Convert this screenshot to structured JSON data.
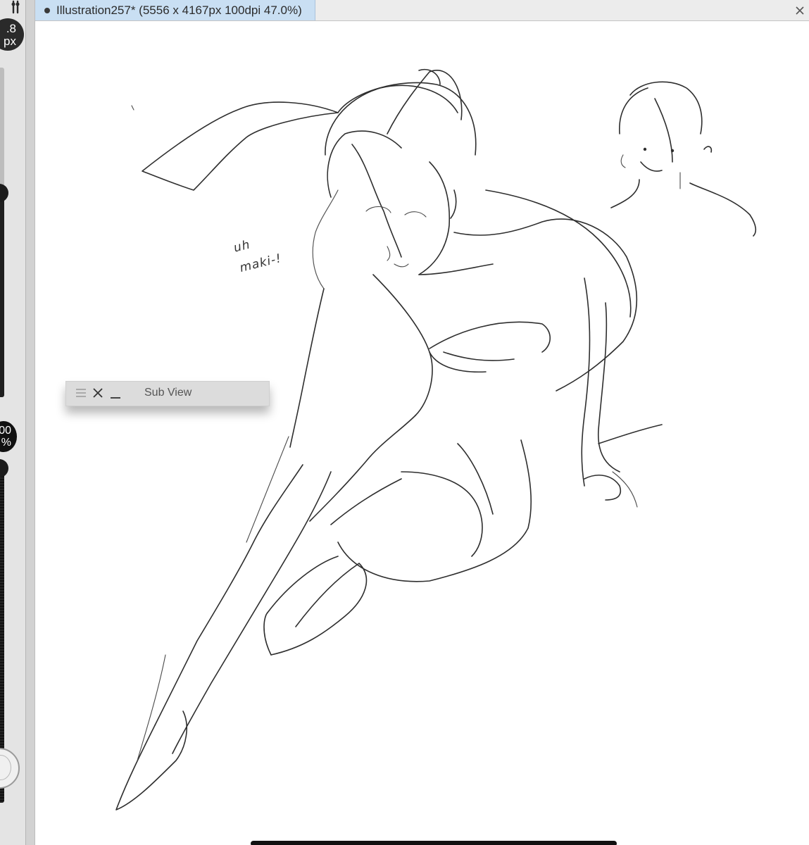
{
  "tool_strip": {
    "brush_size": {
      "line1": ".8",
      "line2": "px"
    },
    "brush_size_level": 0.62,
    "opacity": {
      "line1": "00",
      "line2": "%"
    },
    "opacity_level": 1.0
  },
  "document": {
    "tab_title": "Illustration257* (5556 x 4167px 100dpi 47.0%)"
  },
  "canvas": {
    "note_line1": "uh",
    "note_line2": "maki-!"
  },
  "sub_view": {
    "title": "Sub View"
  },
  "colors": {
    "tab_active": "#c9dff3",
    "panel_bg": "#dcdcdc",
    "stroke": "#2e2e2e"
  },
  "icons": {
    "tab_dot": "bullet-icon",
    "menu": "hamburger-menu-icon",
    "close": "close-icon",
    "minimize": "minimize-icon",
    "handle": "drag-handle-icon"
  }
}
